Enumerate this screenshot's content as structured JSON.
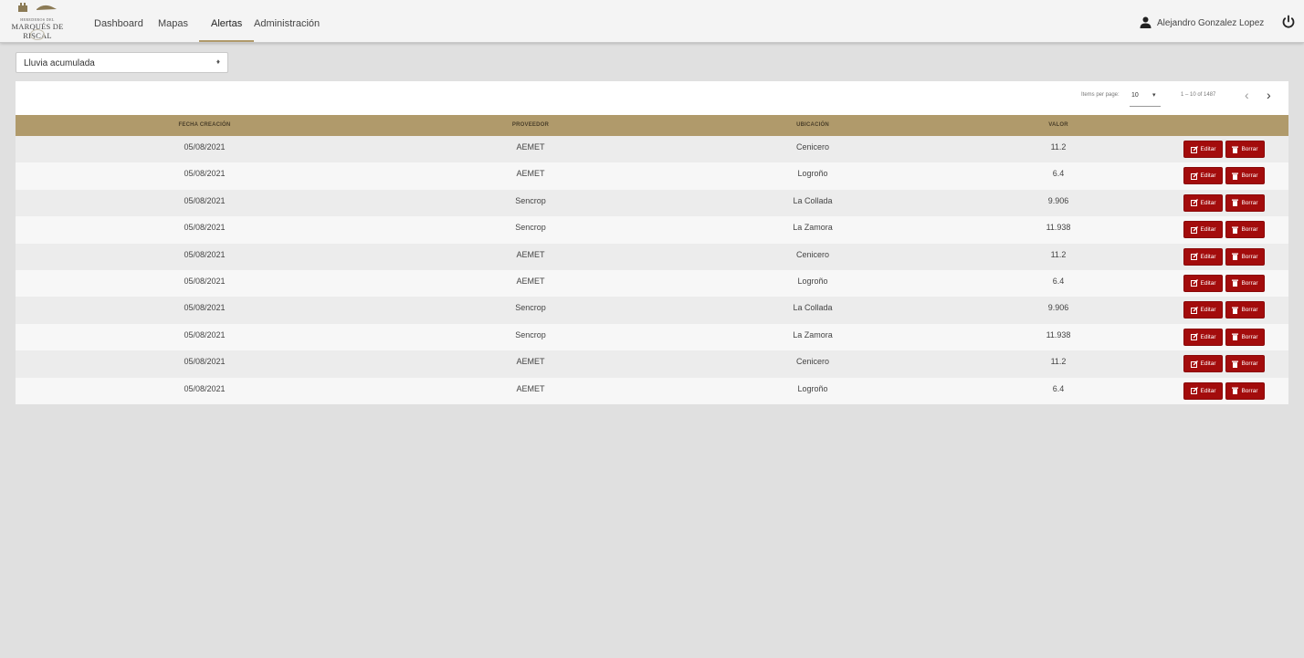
{
  "header": {
    "logo": {
      "top_text": "HEREDEROS DEL",
      "name": "MARQUÉS DE RISCAL"
    },
    "nav": [
      {
        "label": "Dashboard",
        "active": false
      },
      {
        "label": "Mapas",
        "active": false
      },
      {
        "label": "Alertas",
        "active": true
      },
      {
        "label": "Administración",
        "active": false
      }
    ],
    "user_name": "Alejandro Gonzalez Lopez",
    "user_icon": "user-icon",
    "power_icon": "power-icon"
  },
  "filter": {
    "selected": "Lluvia acumulada"
  },
  "paginator": {
    "label": "Items per page:",
    "page_size": "10",
    "range": "1 – 10 of 1487"
  },
  "table": {
    "columns": [
      "FECHA CREACIÓN",
      "PROVEEDOR",
      "UBICACIÓN",
      "VALOR"
    ],
    "edit_label": "Editar",
    "delete_label": "Borrar",
    "rows": [
      {
        "fecha": "05/08/2021",
        "proveedor": "AEMET",
        "ubicacion": "Cenicero",
        "valor": "11.2"
      },
      {
        "fecha": "05/08/2021",
        "proveedor": "AEMET",
        "ubicacion": "Logroño",
        "valor": "6.4"
      },
      {
        "fecha": "05/08/2021",
        "proveedor": "Sencrop",
        "ubicacion": "La Collada",
        "valor": "9.906"
      },
      {
        "fecha": "05/08/2021",
        "proveedor": "Sencrop",
        "ubicacion": "La Zamora",
        "valor": "11.938"
      },
      {
        "fecha": "05/08/2021",
        "proveedor": "AEMET",
        "ubicacion": "Cenicero",
        "valor": "11.2"
      },
      {
        "fecha": "05/08/2021",
        "proveedor": "AEMET",
        "ubicacion": "Logroño",
        "valor": "6.4"
      },
      {
        "fecha": "05/08/2021",
        "proveedor": "Sencrop",
        "ubicacion": "La Collada",
        "valor": "9.906"
      },
      {
        "fecha": "05/08/2021",
        "proveedor": "Sencrop",
        "ubicacion": "La Zamora",
        "valor": "11.938"
      },
      {
        "fecha": "05/08/2021",
        "proveedor": "AEMET",
        "ubicacion": "Cenicero",
        "valor": "11.2"
      },
      {
        "fecha": "05/08/2021",
        "proveedor": "AEMET",
        "ubicacion": "Logroño",
        "valor": "6.4"
      }
    ]
  },
  "colors": {
    "accent": "#b09a6b",
    "button": "#a30c0c"
  }
}
